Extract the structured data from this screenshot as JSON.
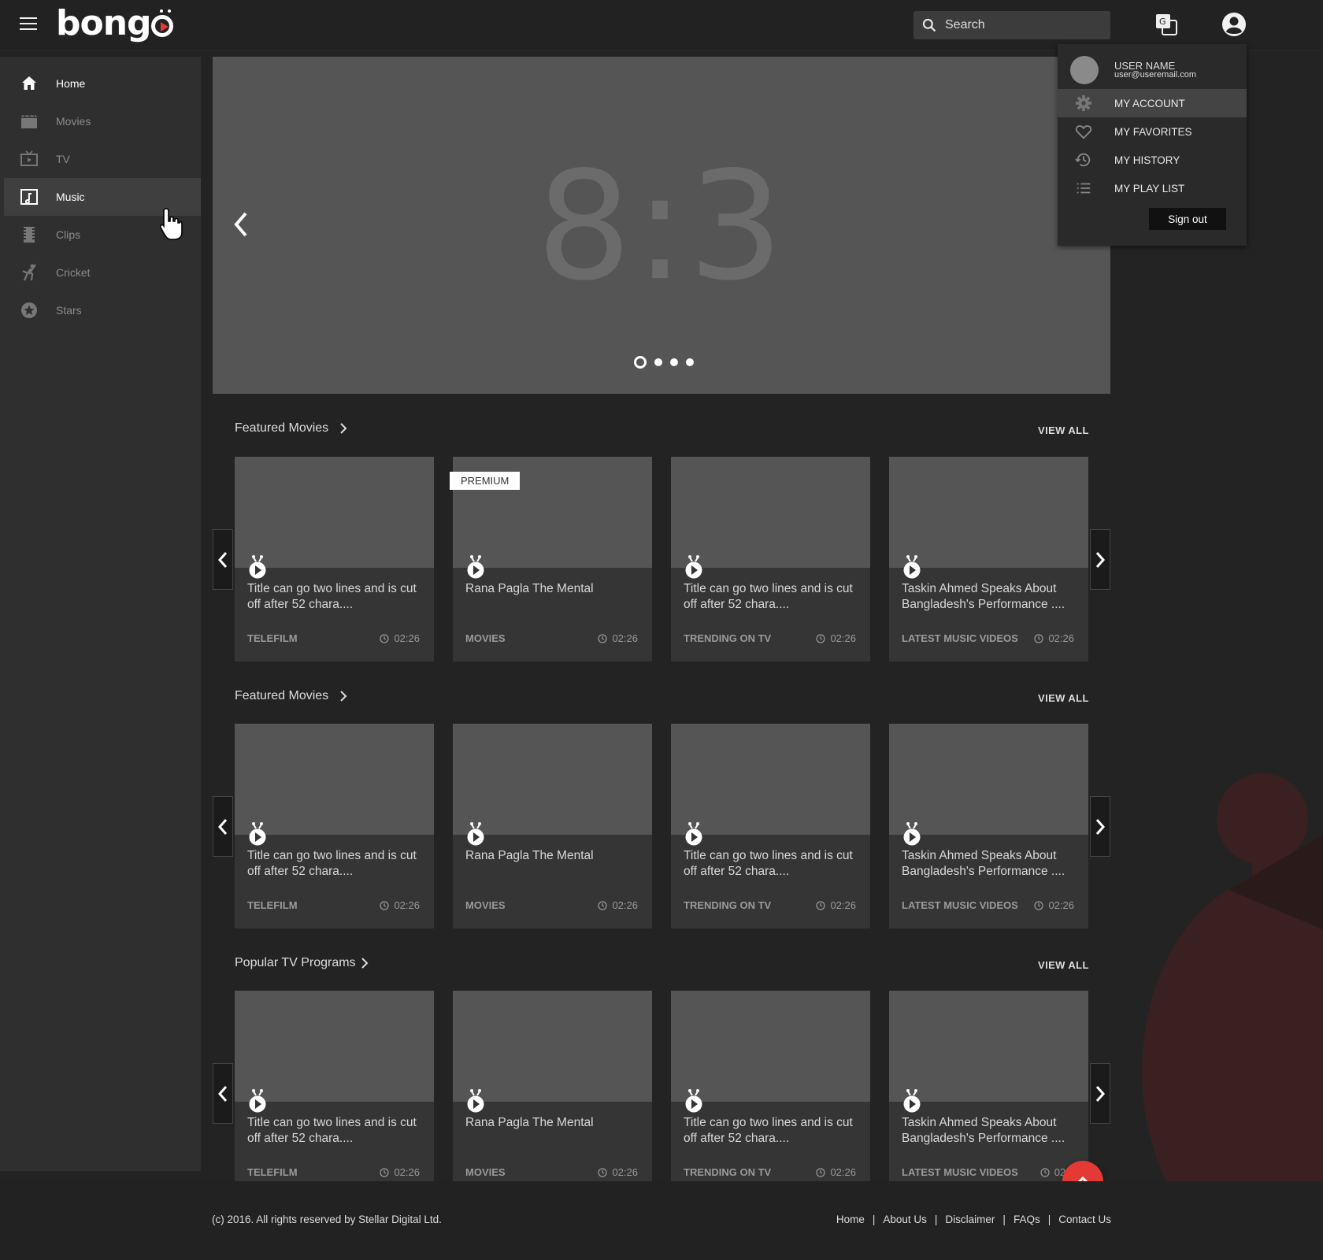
{
  "header": {
    "logo_text": "bong",
    "search_placeholder": "Search"
  },
  "sidebar": {
    "items": [
      {
        "label": "Home",
        "icon": "home-icon"
      },
      {
        "label": "Movies",
        "icon": "clapperboard-icon"
      },
      {
        "label": "TV",
        "icon": "tv-icon"
      },
      {
        "label": "Music",
        "icon": "music-icon"
      },
      {
        "label": "Clips",
        "icon": "film-strip-icon"
      },
      {
        "label": "Cricket",
        "icon": "cricket-icon"
      },
      {
        "label": "Stars",
        "icon": "star-icon"
      }
    ],
    "active": "Music"
  },
  "hero": {
    "ratio_text": "8:3",
    "slide_count": 4,
    "active_slide": 1
  },
  "sections": [
    {
      "title": "Featured Movies",
      "view_all": "VIEW ALL",
      "cards": [
        {
          "title": "Title can go two lines and is cut off after 52 chara....",
          "category": "TELEFILM",
          "duration": "02:26",
          "badge": ""
        },
        {
          "title": "Rana Pagla The Mental",
          "category": "MOVIES",
          "duration": "02:26",
          "badge": "PREMIUM"
        },
        {
          "title": "Title can go two lines and is cut off after 52 chara....",
          "category": "TRENDING ON TV",
          "duration": "02:26",
          "badge": ""
        },
        {
          "title": "Taskin Ahmed Speaks About Bangladesh's Performance ....",
          "category": "LATEST MUSIC VIDEOS",
          "duration": "02:26",
          "badge": ""
        }
      ]
    },
    {
      "title": "Featured Movies",
      "view_all": "VIEW ALL",
      "cards": [
        {
          "title": "Title can go two lines and is cut off after 52 chara....",
          "category": "TELEFILM",
          "duration": "02:26",
          "badge": ""
        },
        {
          "title": "Rana Pagla The Mental",
          "category": "MOVIES",
          "duration": "02:26",
          "badge": ""
        },
        {
          "title": "Title can go two lines and is cut off after 52 chara....",
          "category": "TRENDING ON TV",
          "duration": "02:26",
          "badge": ""
        },
        {
          "title": "Taskin Ahmed Speaks About Bangladesh's Performance ....",
          "category": "LATEST MUSIC VIDEOS",
          "duration": "02:26",
          "badge": ""
        }
      ]
    },
    {
      "title": "Popular TV Programs",
      "view_all": "VIEW ALL",
      "cards": [
        {
          "title": "Title can go two lines and is cut off after 52 chara....",
          "category": "TELEFILM",
          "duration": "02:26",
          "badge": ""
        },
        {
          "title": "Rana Pagla The Mental",
          "category": "MOVIES",
          "duration": "02:26",
          "badge": ""
        },
        {
          "title": "Title can go two lines and is cut off after 52 chara....",
          "category": "TRENDING ON TV",
          "duration": "02:26",
          "badge": ""
        },
        {
          "title": "Taskin Ahmed Speaks About Bangladesh's Performance ....",
          "category": "LATEST MUSIC VIDEOS",
          "duration": "02:2",
          "badge": ""
        }
      ]
    }
  ],
  "user_menu": {
    "user_name": "USER NAME",
    "user_email": "user@useremail.com",
    "items": [
      {
        "label": "MY ACCOUNT",
        "icon": "gear-icon"
      },
      {
        "label": "MY FAVORITES",
        "icon": "heart-icon"
      },
      {
        "label": "MY HISTORY",
        "icon": "history-icon"
      },
      {
        "label": "MY PLAY LIST",
        "icon": "list-icon"
      }
    ],
    "active": "MY ACCOUNT",
    "sign_out": "Sign out"
  },
  "footer": {
    "copyright": "(c) 2016. All rights reserved by Stellar Digital Ltd.",
    "links": [
      "Home",
      "About Us",
      "Disclaimer",
      "FAQs",
      "Contact Us"
    ],
    "separator": "|"
  },
  "colors": {
    "accent": "#e53935",
    "background": "#232323",
    "sidebar": "#2f2f2f",
    "card": "#353535",
    "placeholder": "#555555"
  }
}
